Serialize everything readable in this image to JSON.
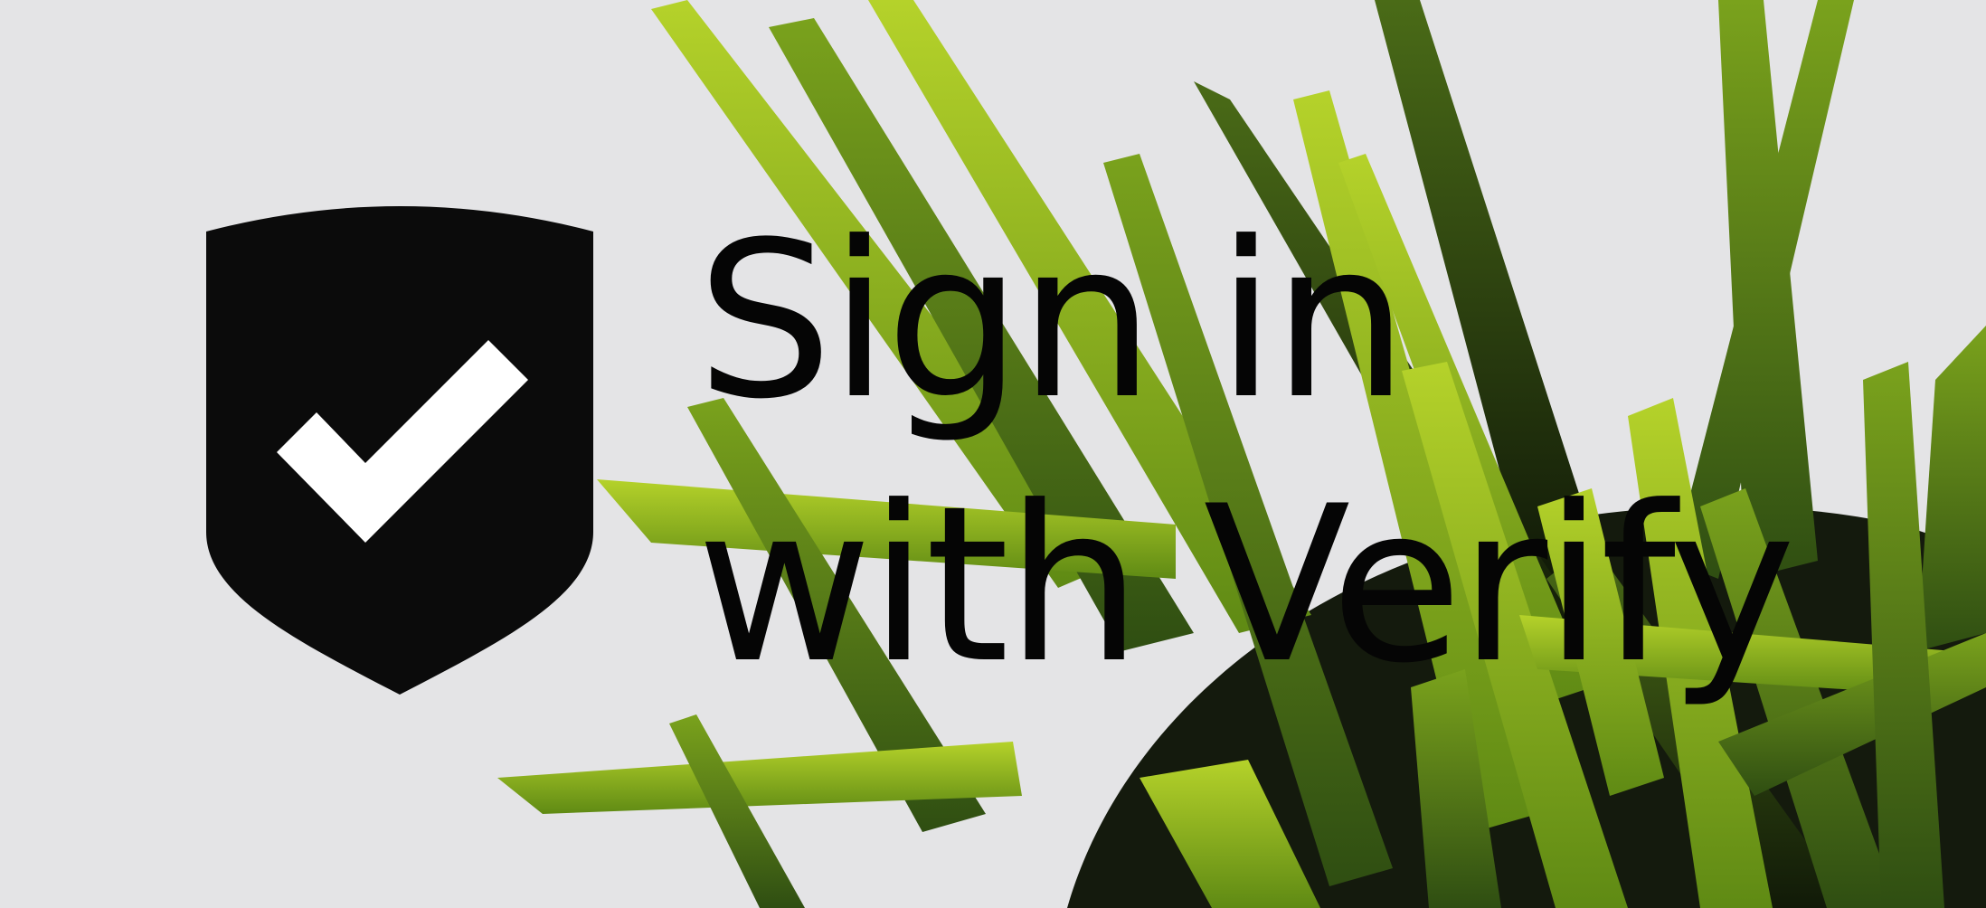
{
  "banner": {
    "headline_line1": "Sign in",
    "headline_line2": "with Verify",
    "background_color": "#e4e4e6",
    "text_color": "#050505",
    "logo_icon": "shield-check-icon",
    "logo_fill": "#0b0b0b",
    "check_color": "#ffffff",
    "decoration": "green-grass-plant-image",
    "leaf_colors": [
      "#9bc21a",
      "#5f8a14",
      "#2f4e12",
      "#1a2a0c"
    ]
  }
}
